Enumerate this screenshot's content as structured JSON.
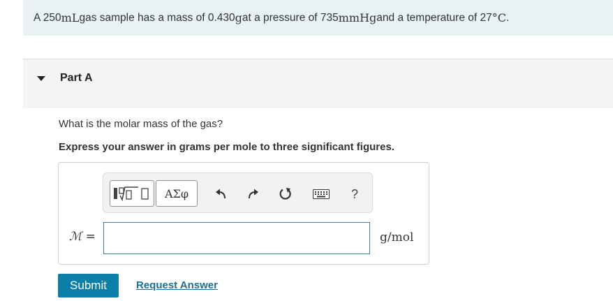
{
  "problem": {
    "prefix": "A 250 ",
    "volume_unit": "mL",
    "mass_text": " gas sample has a mass of 0.430 ",
    "mass_unit": "g",
    "pressure_text": " at a pressure of 735 ",
    "pressure_unit": "mmHg",
    "temp_text": " and a temperature of 27 ",
    "temp_unit": "°C",
    "end": "."
  },
  "part": {
    "title": "Part A",
    "question": "What is the molar mass of the gas?",
    "instruction": "Express your answer in grams per mole to three significant figures."
  },
  "toolbar": {
    "symbols_label": "ΑΣφ",
    "help_label": "?"
  },
  "answer": {
    "variable": "ℳ =",
    "value": "",
    "placeholder": "",
    "unit": "g/mol"
  },
  "actions": {
    "submit_label": "Submit",
    "request_label": "Request Answer"
  },
  "icons": {
    "caret": "caret-down-icon",
    "templates": "templates-sqrt-icon",
    "undo": "undo-icon",
    "redo": "redo-icon",
    "reset": "reset-icon",
    "keyboard": "keyboard-icon"
  },
  "colors": {
    "problem_bg": "#e8f2f5",
    "part_header_bg": "#f3f4f5",
    "submit_bg": "#0b7eaa",
    "link": "#1a6fa0",
    "input_border": "#3a78a6"
  }
}
